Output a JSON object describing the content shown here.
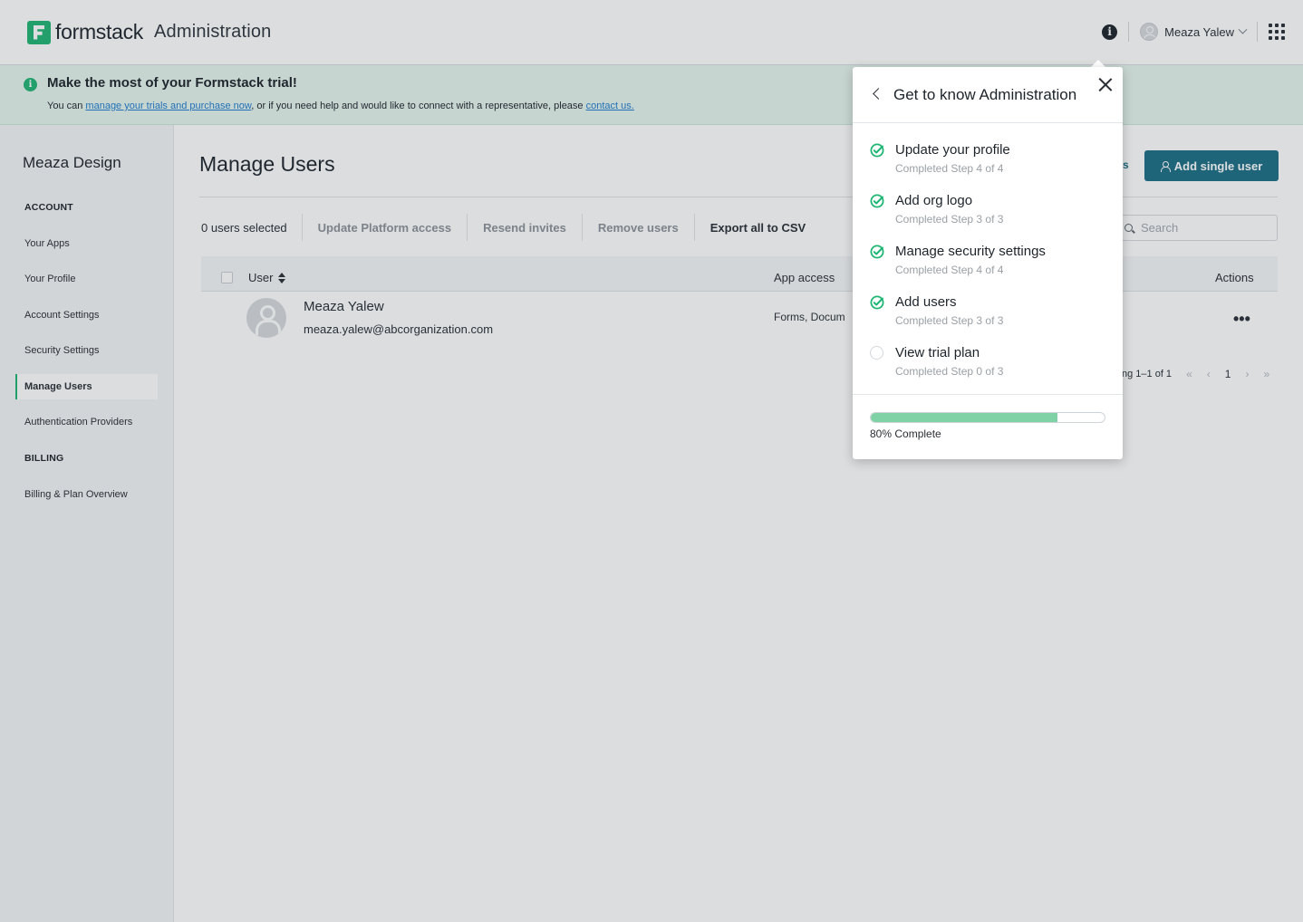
{
  "header": {
    "brand": "formstack",
    "subtitle": "Administration",
    "user_name": "Meaza Yalew"
  },
  "banner": {
    "title": "Make the most of your Formstack trial!",
    "text_pre": "You can ",
    "link1": "manage your trials and purchase now",
    "text_mid": ", or if you need help and would like to connect with a representative, please ",
    "link2": "contact us."
  },
  "sidebar": {
    "org_name": "Meaza Design",
    "account_heading": "ACCOUNT",
    "items": [
      {
        "label": "Your Apps"
      },
      {
        "label": "Your Profile"
      },
      {
        "label": "Account Settings"
      },
      {
        "label": "Security Settings"
      },
      {
        "label": "Manage Users"
      },
      {
        "label": "Authentication Providers"
      }
    ],
    "billing_heading": "BILLING",
    "billing_items": [
      {
        "label": "Billing & Plan Overview"
      }
    ],
    "active": "Manage Users"
  },
  "main": {
    "title": "Manage Users",
    "selected": "0 users selected",
    "actions": [
      {
        "label": "Update Platform access"
      },
      {
        "label": "Resend invites"
      },
      {
        "label": "Remove users"
      },
      {
        "label": "Export all to CSV"
      }
    ],
    "add_button": "Add single user",
    "partial_label": "s",
    "search_placeholder": "Search",
    "columns": {
      "user": "User",
      "app_access": "App access",
      "actions": "Actions"
    },
    "rows": [
      {
        "name": "Meaza Yalew",
        "email": "meaza.yalew@abcorganization.com",
        "app_access": "Forms, Docum",
        "actions": "•••"
      }
    ],
    "pager": {
      "range": "ng 1–1 of 1",
      "first": "«",
      "prev": "‹",
      "current": "1",
      "next": "›",
      "last": "»"
    }
  },
  "popover": {
    "title": "Get to know Administration",
    "steps": [
      {
        "name": "Update your profile",
        "status": "Completed Step 4 of 4",
        "done": true
      },
      {
        "name": "Add org logo",
        "status": "Completed Step 3 of 3",
        "done": true
      },
      {
        "name": "Manage security settings",
        "status": "Completed Step 4 of 4",
        "done": true
      },
      {
        "name": "Add users",
        "status": "Completed Step 3 of 3",
        "done": true
      },
      {
        "name": "View trial plan",
        "status": "Completed Step 0 of 3",
        "done": false
      }
    ],
    "progress": 0.8,
    "progress_label": "80% Complete"
  },
  "colors": {
    "brand_green": "#21b573",
    "primary_button": "#1e6f86",
    "link": "#1f7ccf",
    "progress_fill": "#7fd1a6"
  }
}
